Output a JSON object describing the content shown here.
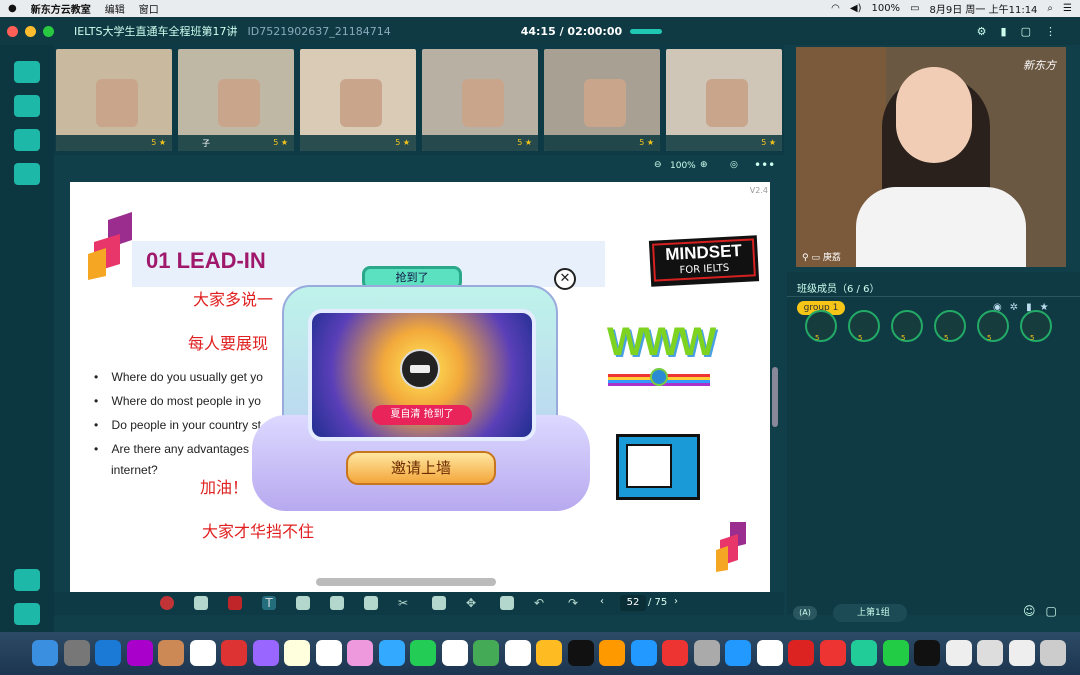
{
  "menubar": {
    "apple": "",
    "app": "新东方云教室",
    "edit": "编辑",
    "window": "窗口",
    "battery": "100%",
    "datetime": "8月9日 周一 上午11:14"
  },
  "titlebar": {
    "title": "IELTS大学生直通车全程班第17讲",
    "room_id": "ID7521902637_21184714",
    "timer": "44:15 / 02:00:00"
  },
  "videos": [
    {
      "name": "",
      "stars": "5"
    },
    {
      "name": "子",
      "stars": "5"
    },
    {
      "name": "",
      "stars": "5"
    },
    {
      "name": "",
      "stars": "5"
    },
    {
      "name": "",
      "stars": "5"
    },
    {
      "name": "",
      "stars": "5"
    }
  ],
  "zoom": "100%",
  "slide": {
    "version": "V2.4",
    "heading": "01 LEAD-IN",
    "logo_line1": "MINDSET",
    "logo_line2": "FOR IELTS",
    "red1": "大家多说一",
    "red2": "每人要展现",
    "bullets": [
      "Where do you usually get yo",
      "Where do most people in yo",
      "Do people in your country st",
      "Are there any advantages t"
    ],
    "bullet_cont": "internet?",
    "cheer1": "加油！",
    "cheer2": "大家才华挡不住",
    "www": "WWW"
  },
  "popup": {
    "tag": "抢到了",
    "winner": "夏自清  抢到了",
    "button": "邀请上墙"
  },
  "toolbar": {
    "page": "52",
    "total": "/ 75"
  },
  "teacher": {
    "name": "庚荔",
    "logo": "新东方"
  },
  "members": {
    "title": "班级成员（6 / 6）",
    "group": "group 1",
    "stars": [
      "5",
      "5",
      "5",
      "5",
      "5",
      "5"
    ]
  },
  "bottom": {
    "mode": "(A)",
    "stage": "上第1组"
  },
  "colors": {
    "accent": "#1fc7b2",
    "slide_red": "#e02020",
    "heading": "#a0186c"
  }
}
